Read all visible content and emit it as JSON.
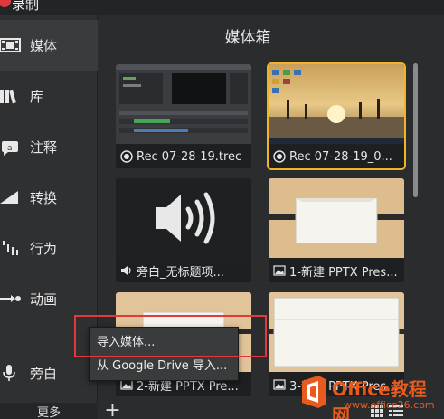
{
  "topbar": {
    "record_label": "录制"
  },
  "sidebar": {
    "items": [
      {
        "label": "媒体",
        "icon": "film-strip-icon"
      },
      {
        "label": "库",
        "icon": "library-books-icon"
      },
      {
        "label": "注释",
        "icon": "annotation-callout-icon"
      },
      {
        "label": "转换",
        "icon": "transition-icon"
      },
      {
        "label": "行为",
        "icon": "behavior-icon"
      },
      {
        "label": "动画",
        "icon": "animation-arrow-icon"
      },
      {
        "label": "旁白",
        "icon": "microphone-icon"
      }
    ],
    "more_label": "更多"
  },
  "media_bin": {
    "title": "媒体箱",
    "items": [
      {
        "name": "Rec 07-28-19.trec",
        "type": "recording",
        "selected": false
      },
      {
        "name": "Rec 07-28-19_0...",
        "type": "recording",
        "selected": true
      },
      {
        "name": "旁白_无标题项...",
        "type": "audio",
        "selected": false
      },
      {
        "name": "1-新建 PPTX Pres...",
        "type": "image",
        "selected": false
      },
      {
        "name": "2-新建 PPTX Pre...",
        "type": "image",
        "selected": false
      },
      {
        "name": "3-新建 PPTX Pres...",
        "type": "image",
        "selected": false
      }
    ]
  },
  "context_menu": {
    "items": [
      {
        "label": "导入媒体..."
      },
      {
        "label": "从 Google Drive 导入..."
      }
    ]
  },
  "bottom_bar": {
    "add_label": "+"
  },
  "watermark": {
    "brand": "Office教程网",
    "url": "www.office26.com"
  },
  "colors": {
    "accent_selected": "#f0b429",
    "highlight_box": "#e0393e",
    "watermark": "#e85a1e",
    "record": "#e0393e"
  }
}
